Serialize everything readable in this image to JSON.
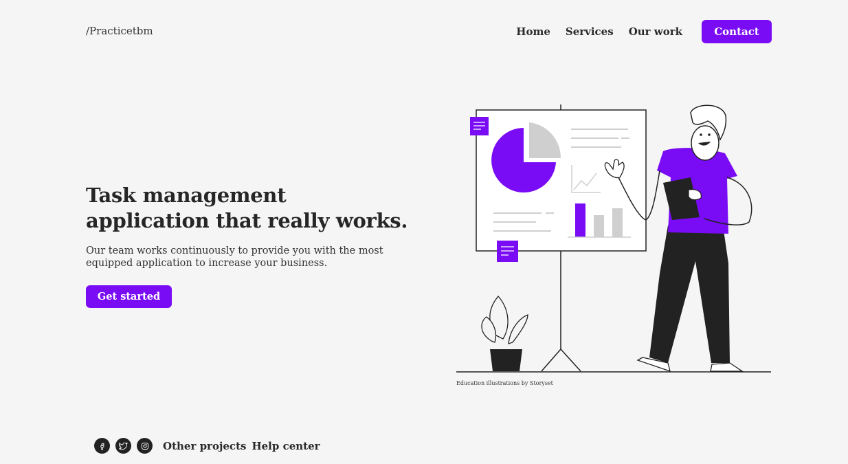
{
  "header": {
    "logo": "/Practicetbm",
    "nav": [
      "Home",
      "Services",
      "Our work"
    ],
    "contact_label": "Contact"
  },
  "hero": {
    "title": "Task management application that really works.",
    "subtitle": "Our team works continuously to provide you with the most equipped application to increase your business.",
    "cta_label": "Get started"
  },
  "illustration": {
    "credit": "Education illustrations by Storyset",
    "accent": "#7a0cf5"
  },
  "footer": {
    "social_icons": [
      "facebook-icon",
      "twitter-icon",
      "instagram-icon"
    ],
    "links": [
      "Other projects",
      "Help center"
    ]
  }
}
